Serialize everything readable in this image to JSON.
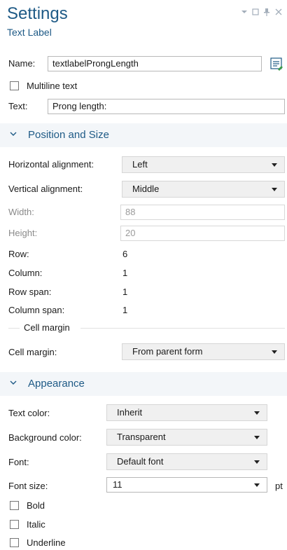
{
  "header": {
    "title": "Settings",
    "subtitle": "Text Label"
  },
  "window_controls": [
    "chevron-down-icon",
    "maximize-icon",
    "pin-icon",
    "close-icon"
  ],
  "name_row": {
    "label": "Name:",
    "value": "textlabelProngLength",
    "icon": "edit-form-icon"
  },
  "multiline": {
    "label": "Multiline text",
    "checked": false
  },
  "text_row": {
    "label": "Text:",
    "value": "Prong length:"
  },
  "position_section": {
    "title": "Position and Size",
    "horizontal_alignment": {
      "label": "Horizontal alignment:",
      "value": "Left"
    },
    "vertical_alignment": {
      "label": "Vertical alignment:",
      "value": "Middle"
    },
    "width": {
      "label": "Width:",
      "value": "88"
    },
    "height": {
      "label": "Height:",
      "value": "20"
    },
    "row": {
      "label": "Row:",
      "value": "6"
    },
    "column": {
      "label": "Column:",
      "value": "1"
    },
    "row_span": {
      "label": "Row span:",
      "value": "1"
    },
    "column_span": {
      "label": "Column span:",
      "value": "1"
    },
    "cell_margin_group": "Cell margin",
    "cell_margin": {
      "label": "Cell margin:",
      "value": "From parent form"
    }
  },
  "appearance_section": {
    "title": "Appearance",
    "text_color": {
      "label": "Text color:",
      "value": "Inherit"
    },
    "background_color": {
      "label": "Background color:",
      "value": "Transparent"
    },
    "font": {
      "label": "Font:",
      "value": "Default font"
    },
    "font_size": {
      "label": "Font size:",
      "value": "11",
      "unit": "pt"
    },
    "bold": {
      "label": "Bold",
      "checked": false
    },
    "italic": {
      "label": "Italic",
      "checked": false
    },
    "underline": {
      "label": "Underline",
      "checked": false
    }
  },
  "colors": {
    "accent": "#1e5a86",
    "section_bg": "#f3f6f9"
  }
}
